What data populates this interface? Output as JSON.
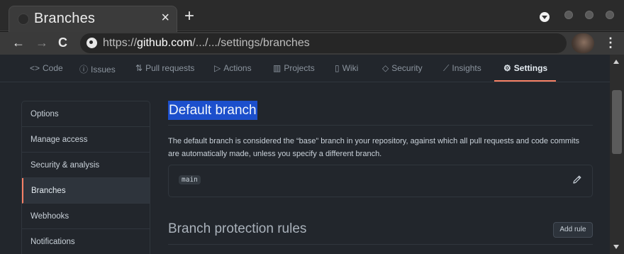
{
  "browser": {
    "tab_title": "Branches",
    "close_glyph": "×",
    "new_tab_glyph": "+",
    "url_scheme": "https://",
    "url_host": "github.com",
    "url_path": "/.../.../settings/branches",
    "back_glyph": "←",
    "forward_glyph": "→",
    "reload_glyph": "C",
    "menu_glyph": "⋮"
  },
  "repo_nav": {
    "items": [
      {
        "label": "Code",
        "icon": "code-icon",
        "glyph": "<>"
      },
      {
        "label": "Issues",
        "icon": "issue-icon",
        "glyph": "ⓘ"
      },
      {
        "label": "Pull requests",
        "icon": "pull-request-icon",
        "glyph": "⇅"
      },
      {
        "label": "Actions",
        "icon": "play-icon",
        "glyph": "▷"
      },
      {
        "label": "Projects",
        "icon": "project-icon",
        "glyph": "▥"
      },
      {
        "label": "Wiki",
        "icon": "book-icon",
        "glyph": "▯"
      },
      {
        "label": "Security",
        "icon": "shield-icon",
        "glyph": "◇"
      },
      {
        "label": "Insights",
        "icon": "graph-icon",
        "glyph": "⟋"
      },
      {
        "label": "Settings",
        "icon": "gear-icon",
        "glyph": "⚙"
      }
    ],
    "selected": "Settings"
  },
  "side_menu": {
    "items": [
      "Options",
      "Manage access",
      "Security & analysis",
      "Branches",
      "Webhooks",
      "Notifications"
    ],
    "active": "Branches"
  },
  "default_branch": {
    "heading": "Default branch",
    "description": "The default branch is considered the “base” branch in your repository, against which all pull requests and code commits are automatically made, unless you specify a different branch.",
    "branch": "main"
  },
  "protection": {
    "heading": "Branch protection rules",
    "add_button": "Add rule"
  },
  "colors": {
    "accent_underline": "#f78166",
    "selection": "#1c4fcc"
  }
}
